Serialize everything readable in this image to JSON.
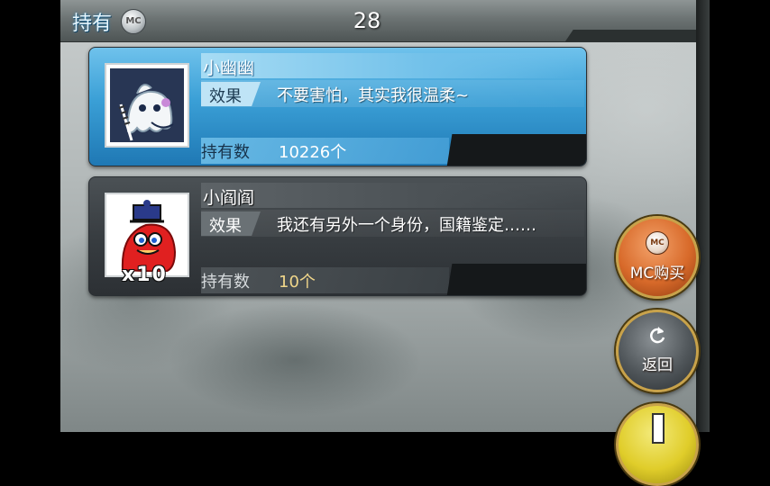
{
  "header": {
    "title": "持有",
    "currency_icon": "mc-coin-icon",
    "currency_text": "MC",
    "count": "28"
  },
  "items": [
    {
      "name": "小幽幽",
      "effect_label": "效果",
      "effect": "不要害怕，其实我很温柔~",
      "hold_label": "持有数",
      "hold_value": "10226个",
      "selected": true,
      "multiplier": ""
    },
    {
      "name": "小阎阎",
      "effect_label": "效果",
      "effect": "我还有另外一个身份，国籍鉴定……",
      "hold_label": "持有数",
      "hold_value": "10个",
      "selected": false,
      "multiplier": "x10"
    }
  ],
  "buttons": {
    "mc_buy": "MC购买",
    "mc_buy_icon_text": "MC",
    "back": "返回"
  },
  "colors": {
    "selected_card": "#3a9fd6",
    "normal_card": "#383d41",
    "mc_button": "#d86a2a",
    "back_button": "#50565a",
    "next_button": "#e0cd2a",
    "title_text": "#e8f7ff",
    "hold_value_normal": "#f0d68a"
  }
}
